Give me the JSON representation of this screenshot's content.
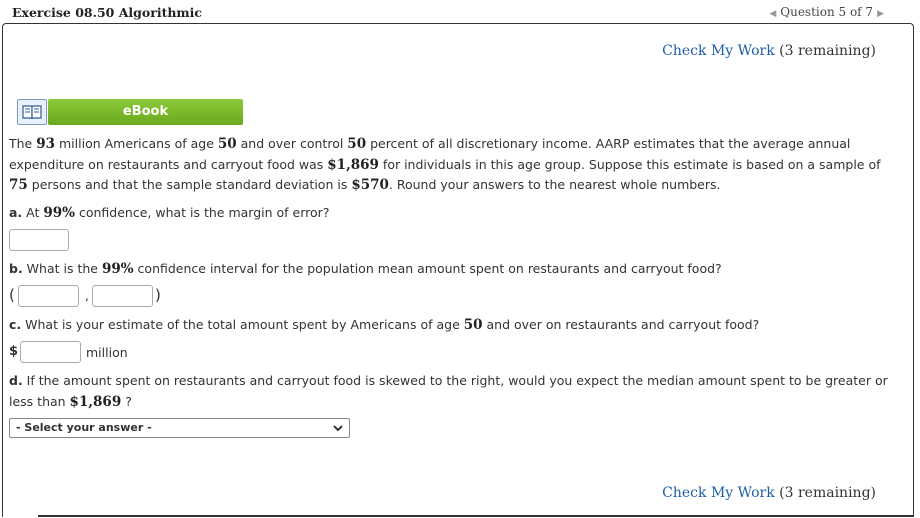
{
  "header": {
    "exercise_title": "Exercise 08.50 Algorithmic",
    "question_nav": "Question 5 of 7"
  },
  "check_work": {
    "link": "Check My Work",
    "remaining": "(3 remaining)"
  },
  "ebook": {
    "label": "eBook"
  },
  "problem": {
    "intro_parts": [
      "The ",
      "93",
      " million Americans of age ",
      "50",
      " and over control ",
      "50",
      " percent of all discretionary income. AARP estimates that the average annual expenditure on restaurants and carryout food was ",
      "$1,869",
      " for individuals in this age group. Suppose this estimate is based on a sample of ",
      "75",
      " persons and that the sample standard deviation is ",
      "$570",
      ". Round your answers to the nearest whole numbers."
    ]
  },
  "part_a": {
    "label": "a.",
    "pre": " At ",
    "num": "99%",
    "post": " confidence, what is the margin of error?"
  },
  "part_b": {
    "label": "b.",
    "pre": " What is the ",
    "num": "99%",
    "post": " confidence interval for the population mean amount spent on restaurants and carryout food?",
    "open": "(",
    "comma": ",",
    "close": ")"
  },
  "part_c": {
    "label": "c.",
    "pre": " What is your estimate of the total amount spent by Americans of age ",
    "num": "50",
    "post": " and over on restaurants and carryout food?",
    "currency": "$",
    "unit": "million"
  },
  "part_d": {
    "label": "d.",
    "pre": " If the amount spent on restaurants and carryout food is skewed to the right, would you expect the median amount spent to be greater or less than ",
    "num": "$1,869",
    "post": " ?",
    "select_value": "- Select your answer -"
  }
}
